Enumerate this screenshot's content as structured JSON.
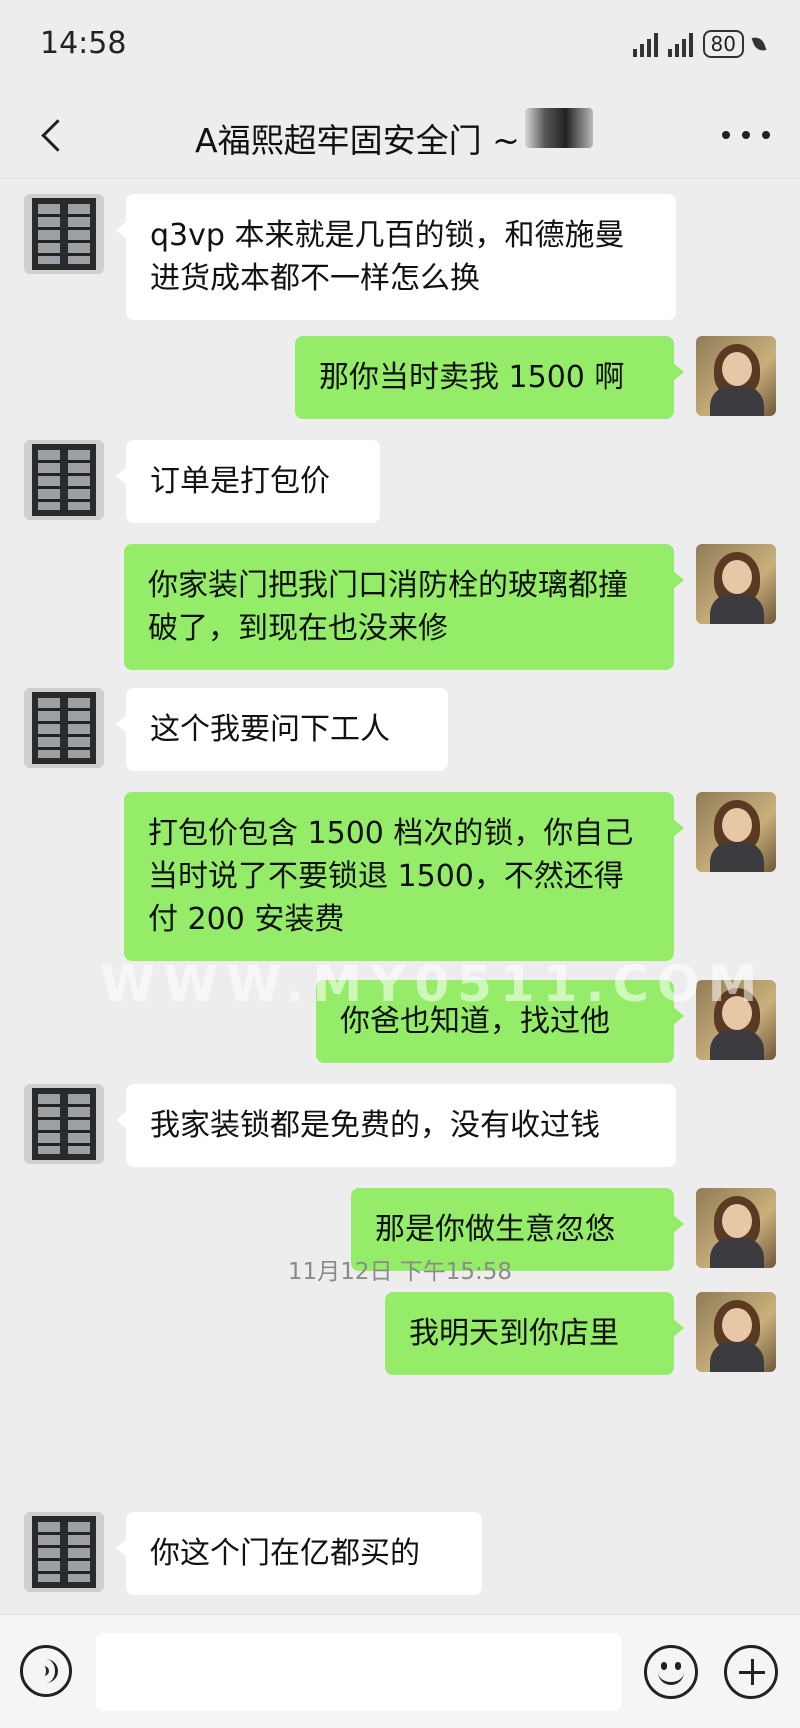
{
  "status_bar": {
    "time": "14:58",
    "battery": "80"
  },
  "nav": {
    "title": "A福熙超牢固安全门 ~"
  },
  "messages": [
    {
      "side": "in",
      "text": "q3vp 本来就是几百的锁，和德施曼进货成本都不一样怎么换"
    },
    {
      "side": "out",
      "text": "那你当时卖我 1500 啊"
    },
    {
      "side": "in",
      "text": "订单是打包价"
    },
    {
      "side": "out",
      "text": "你家装门把我门口消防栓的玻璃都撞破了，到现在也没来修"
    },
    {
      "side": "in",
      "text": "这个我要问下工人"
    },
    {
      "side": "out",
      "text": "打包价包含 1500 档次的锁，你自己当时说了不要锁退 1500，不然还得付 200 安装费"
    },
    {
      "side": "out",
      "text": "你爸也知道，找过他"
    },
    {
      "side": "in",
      "text": "我家装锁都是免费的，没有收过钱"
    },
    {
      "side": "out",
      "text": "那是你做生意忽悠"
    },
    {
      "side": "out",
      "text": "我明天到你店里"
    },
    {
      "side": "in",
      "text": "你这个门在亿都买的"
    }
  ],
  "timestamp": "11月12日 下午15:58",
  "watermark": "WWW.MY0511.COM",
  "input": {
    "placeholder": ""
  },
  "icons": {
    "back": "chevron-left-icon",
    "more": "more-dots-icon",
    "voice": "voice-icon",
    "emoji": "emoji-icon",
    "plus": "plus-icon"
  },
  "colors": {
    "background": "#ededed",
    "outgoing_bubble": "#95ec69",
    "incoming_bubble": "#ffffff"
  }
}
